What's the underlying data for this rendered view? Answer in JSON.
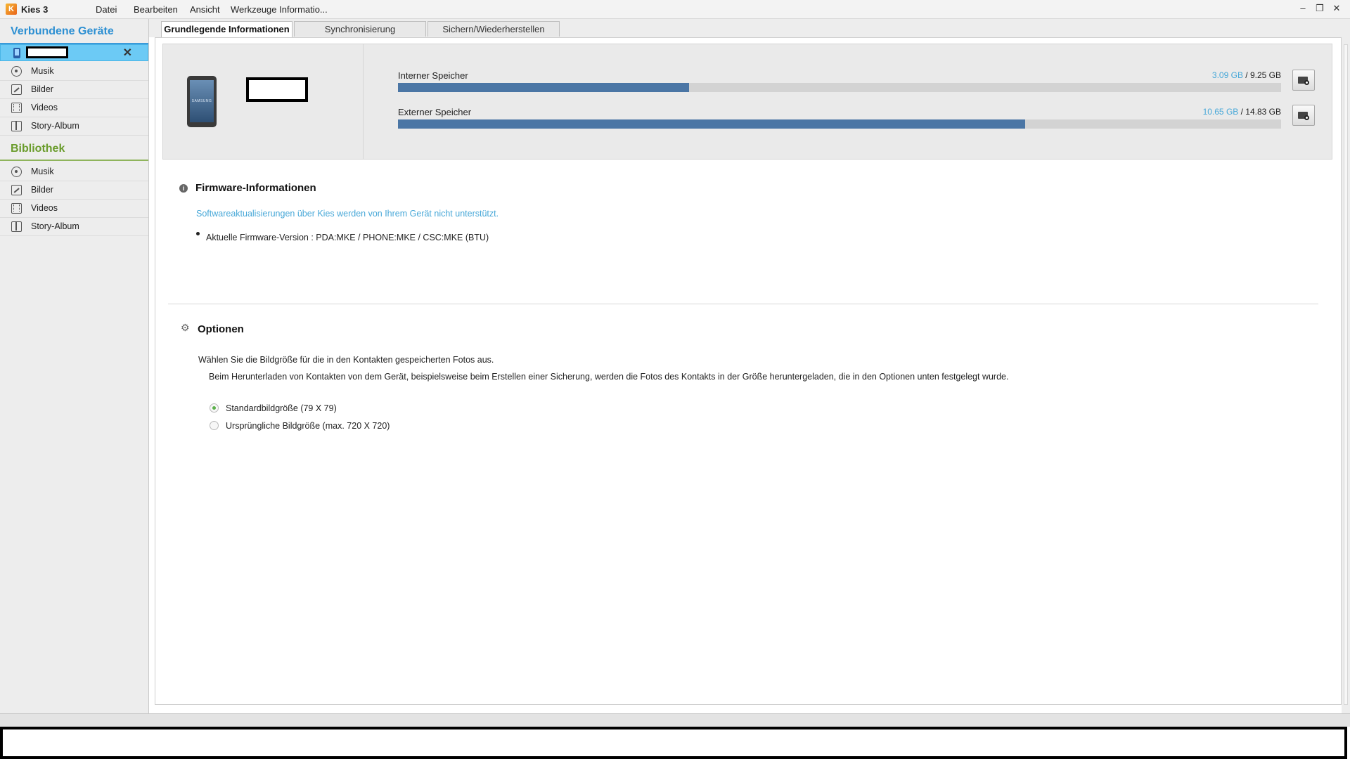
{
  "app": {
    "title": "Kies 3",
    "logo_glyph": "K"
  },
  "menu": [
    "Datei",
    "Bearbeiten",
    "Ansicht",
    "Werkzeuge Informatio..."
  ],
  "window_controls": {
    "minimize": "–",
    "restore": "❐",
    "close": "✕"
  },
  "sidebar": {
    "devices_header": "Verbundene Geräte",
    "device_name": "",
    "device_close": "✕",
    "device_items": [
      {
        "label": "Musik",
        "icon": "music-icon"
      },
      {
        "label": "Bilder",
        "icon": "pictures-icon"
      },
      {
        "label": "Videos",
        "icon": "video-icon"
      },
      {
        "label": "Story-Album",
        "icon": "story-album-icon"
      }
    ],
    "library_header": "Bibliothek",
    "library_items": [
      {
        "label": "Musik",
        "icon": "music-icon"
      },
      {
        "label": "Bilder",
        "icon": "pictures-icon"
      },
      {
        "label": "Videos",
        "icon": "video-icon"
      },
      {
        "label": "Story-Album",
        "icon": "story-album-icon"
      }
    ]
  },
  "tabs": [
    {
      "label": "Grundlegende Informationen",
      "active": true
    },
    {
      "label": "Synchronisierung",
      "active": false
    },
    {
      "label": "Sichern/Wiederherstellen",
      "active": false
    }
  ],
  "device_panel": {
    "brand": "SAMSUNG",
    "device_name": "",
    "internal": {
      "label": "Interner Speicher",
      "used": "3.09 GB",
      "separator": " / ",
      "total": "9.25 GB",
      "used_fraction": 0.33
    },
    "external": {
      "label": "Externer Speicher",
      "used": "10.65 GB",
      "separator": " / ",
      "total": "14.83 GB",
      "used_fraction": 0.71
    }
  },
  "firmware": {
    "title": "Firmware-Informationen",
    "note": "Softwareaktualisierungen über Kies werden von Ihrem Gerät nicht unterstützt.",
    "version_line": "Aktuelle Firmware-Version : PDA:MKE / PHONE:MKE / CSC:MKE (BTU)"
  },
  "options": {
    "title": "Optionen",
    "description": "Wählen Sie die Bildgröße für die in den Kontakten gespeicherten Fotos aus.",
    "subdescription": "Beim Herunterladen von Kontakten von dem Gerät, beispielsweise beim Erstellen einer Sicherung, werden die Fotos des Kontakts in der Größe heruntergeladen, die in den Optionen unten festgelegt wurde.",
    "radios": [
      {
        "label": "Standardbildgröße (79 X 79)",
        "checked": true
      },
      {
        "label": "Ursprüngliche Bildgröße (max. 720 X 720)",
        "checked": false
      }
    ]
  },
  "colors": {
    "accent_blue": "#2c8fd2",
    "library_green": "#6a9c2c",
    "selected_row": "#6ccaf5",
    "storage_bar": "#4b76a5",
    "used_text": "#48a8d8"
  }
}
